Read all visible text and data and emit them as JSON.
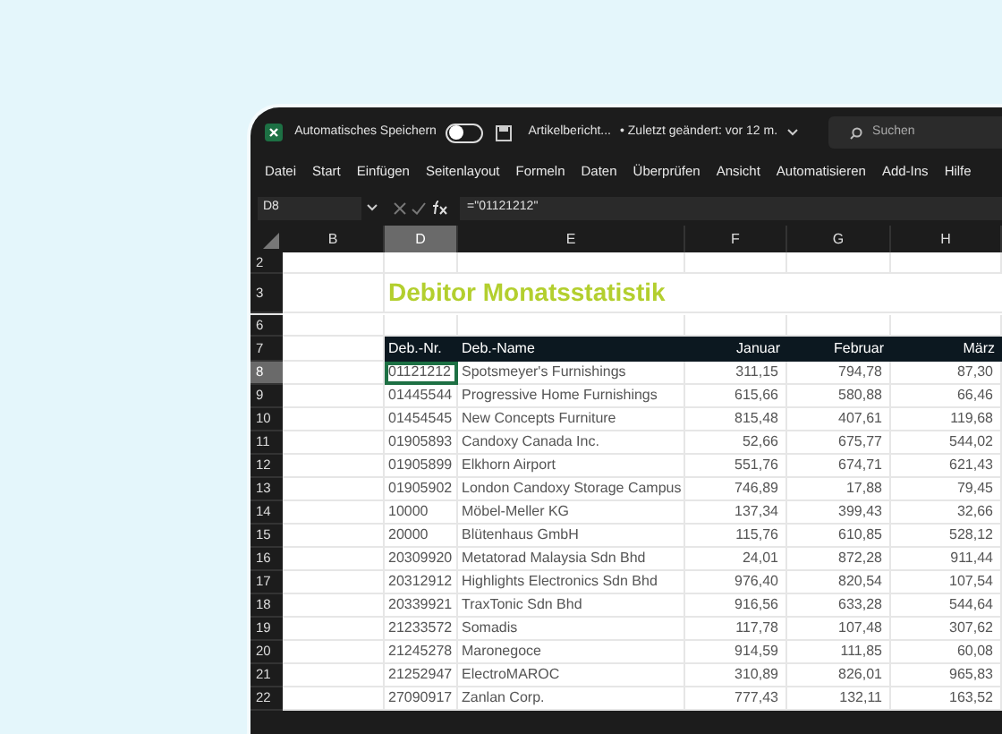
{
  "title_bar": {
    "autosave_label": "Automatisches Speichern",
    "autosave_on": false,
    "document": "Artikelbericht...",
    "modified": "• Zuletzt geändert: vor 12 m.",
    "search": {
      "placeholder": "Suchen"
    }
  },
  "menu": [
    {
      "label": "Datei"
    },
    {
      "label": "Start"
    },
    {
      "label": "Einfügen"
    },
    {
      "label": "Seitenlayout"
    },
    {
      "label": "Formeln"
    },
    {
      "label": "Daten"
    },
    {
      "label": "Überprüfen"
    },
    {
      "label": "Ansicht"
    },
    {
      "label": "Automatisieren"
    },
    {
      "label": "Add-Ins"
    },
    {
      "label": "Hilfe"
    }
  ],
  "formula_bar": {
    "name_box": "D8",
    "formula": "=\"01121212\""
  },
  "columns": [
    {
      "label": "B",
      "selected": false
    },
    {
      "label": "D",
      "selected": true
    },
    {
      "label": "E",
      "selected": false
    },
    {
      "label": "F",
      "selected": false
    },
    {
      "label": "G",
      "selected": false
    },
    {
      "label": "H",
      "selected": false
    }
  ],
  "rows": [
    {
      "number": "2",
      "selected": false,
      "kind": "blank"
    },
    {
      "number": "3",
      "selected": false,
      "kind": "title",
      "title": "Debitor Monatsstatistik"
    },
    {
      "number": "6",
      "selected": false,
      "kind": "blank"
    },
    {
      "number": "7",
      "selected": false,
      "kind": "header",
      "cells": [
        "Deb.-Nr.",
        "Deb.-Name",
        "Januar",
        "Februar",
        "März"
      ]
    },
    {
      "number": "8",
      "selected": true,
      "kind": "data",
      "cells": [
        "01121212",
        "Spotsmeyer's Furnishings",
        "311,15",
        "794,78",
        "87,30"
      ]
    },
    {
      "number": "9",
      "selected": false,
      "kind": "data",
      "cells": [
        "01445544",
        "Progressive Home Furnishings",
        "615,66",
        "580,88",
        "66,46"
      ]
    },
    {
      "number": "10",
      "selected": false,
      "kind": "data",
      "cells": [
        "01454545",
        "New Concepts Furniture",
        "815,48",
        "407,61",
        "119,68"
      ]
    },
    {
      "number": "11",
      "selected": false,
      "kind": "data",
      "cells": [
        "01905893",
        "Candoxy Canada Inc.",
        "52,66",
        "675,77",
        "544,02"
      ]
    },
    {
      "number": "12",
      "selected": false,
      "kind": "data",
      "cells": [
        "01905899",
        "Elkhorn Airport",
        "551,76",
        "674,71",
        "621,43"
      ]
    },
    {
      "number": "13",
      "selected": false,
      "kind": "data",
      "cells": [
        "01905902",
        "London Candoxy Storage Campus",
        "746,89",
        "17,88",
        "79,45"
      ]
    },
    {
      "number": "14",
      "selected": false,
      "kind": "data",
      "cells": [
        "10000",
        "Möbel-Meller KG",
        "137,34",
        "399,43",
        "32,66"
      ]
    },
    {
      "number": "15",
      "selected": false,
      "kind": "data",
      "cells": [
        "20000",
        "Blütenhaus GmbH",
        "115,76",
        "610,85",
        "528,12"
      ]
    },
    {
      "number": "16",
      "selected": false,
      "kind": "data",
      "cells": [
        "20309920",
        "Metatorad Malaysia Sdn Bhd",
        "24,01",
        "872,28",
        "911,44"
      ]
    },
    {
      "number": "17",
      "selected": false,
      "kind": "data",
      "cells": [
        "20312912",
        "Highlights Electronics Sdn Bhd",
        "976,40",
        "820,54",
        "107,54"
      ]
    },
    {
      "number": "18",
      "selected": false,
      "kind": "data",
      "cells": [
        "20339921",
        "TraxTonic Sdn Bhd",
        "916,56",
        "633,28",
        "544,64"
      ]
    },
    {
      "number": "19",
      "selected": false,
      "kind": "data",
      "cells": [
        "21233572",
        "Somadis",
        "117,78",
        "107,48",
        "307,62"
      ]
    },
    {
      "number": "20",
      "selected": false,
      "kind": "data",
      "cells": [
        "21245278",
        "Maronegoce",
        "914,59",
        "111,85",
        "60,08"
      ]
    },
    {
      "number": "21",
      "selected": false,
      "kind": "data",
      "cells": [
        "21252947",
        "ElectroMAROC",
        "310,89",
        "826,01",
        "965,83"
      ]
    },
    {
      "number": "22",
      "selected": false,
      "kind": "data",
      "cells": [
        "27090917",
        "Zanlan Corp.",
        "777,43",
        "132,11",
        "163,52"
      ]
    }
  ]
}
